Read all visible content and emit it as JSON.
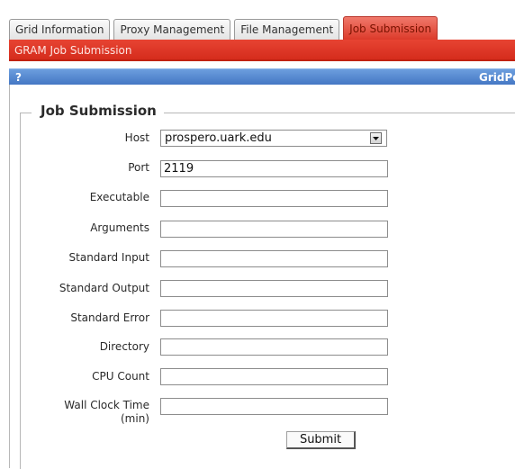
{
  "tabs": [
    {
      "label": "Grid Information",
      "active": false
    },
    {
      "label": "Proxy Management",
      "active": false
    },
    {
      "label": "File Management",
      "active": false
    },
    {
      "label": "Job Submission",
      "active": true
    }
  ],
  "subtab": {
    "label": "GRAM Job Submission"
  },
  "portlet": {
    "help": "?",
    "title": "GridPo"
  },
  "form": {
    "legend": "Job Submission",
    "host": {
      "label": "Host",
      "value": "prospero.uark.edu",
      "icon": "chevron-down-icon"
    },
    "port": {
      "label": "Port",
      "value": "2119"
    },
    "executable": {
      "label": "Executable",
      "value": ""
    },
    "arguments": {
      "label": "Arguments",
      "value": ""
    },
    "standard_input": {
      "label": "Standard Input",
      "value": ""
    },
    "standard_output": {
      "label": "Standard Output",
      "value": ""
    },
    "standard_error": {
      "label": "Standard Error",
      "value": ""
    },
    "directory": {
      "label": "Directory",
      "value": ""
    },
    "cpu_count": {
      "label": "CPU Count",
      "value": ""
    },
    "wall_clock": {
      "label_line1": "Wall Clock Time",
      "label_line2": "(min)",
      "value": ""
    },
    "submit_label": "Submit"
  },
  "colors": {
    "active_tab": "#dc3a2a",
    "subbar": "#d52c1c",
    "portlet_bar": "#4477c4"
  }
}
